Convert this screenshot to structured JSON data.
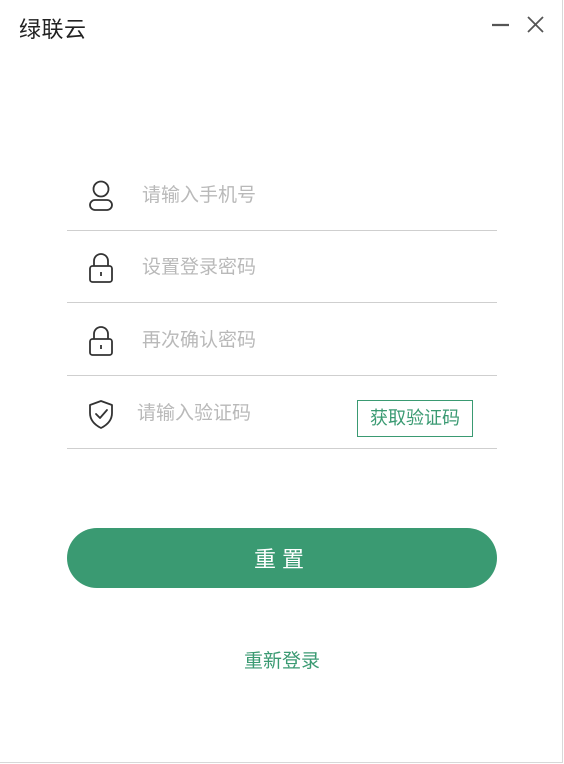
{
  "window": {
    "title": "绿联云"
  },
  "form": {
    "phone_placeholder": "请输入手机号",
    "password_placeholder": "设置登录密码",
    "confirm_placeholder": "再次确认密码",
    "code_placeholder": "请输入验证码",
    "get_code_label": "获取验证码"
  },
  "actions": {
    "reset_label": "重置",
    "relogin_label": "重新登录"
  },
  "icons": {
    "minimize": "minimize-icon",
    "close": "close-icon",
    "user": "user-icon",
    "lock": "lock-icon",
    "shield": "shield-check-icon"
  },
  "colors": {
    "accent": "#3a9a72",
    "placeholder": "#b9b9b9",
    "divider": "#cfcfcf"
  }
}
